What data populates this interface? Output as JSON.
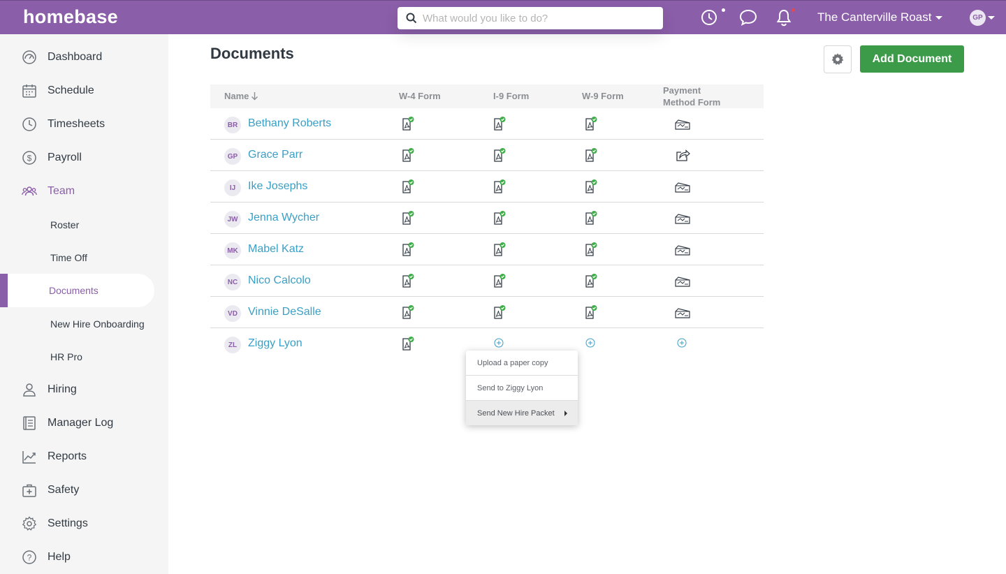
{
  "app": {
    "logo": "homebase"
  },
  "topbar": {
    "search_placeholder": "What would you like to do?",
    "location": "The Canterville Roast",
    "user_initials": "GP",
    "notification_dot_color": "#e5484d"
  },
  "sidebar": {
    "items": [
      {
        "label": "Dashboard",
        "icon": "dashboard-icon"
      },
      {
        "label": "Schedule",
        "icon": "calendar-icon"
      },
      {
        "label": "Timesheets",
        "icon": "clock-icon"
      },
      {
        "label": "Payroll",
        "icon": "dollar-icon"
      },
      {
        "label": "Team",
        "icon": "team-icon",
        "active": true
      },
      {
        "label": "Hiring",
        "icon": "person-icon"
      },
      {
        "label": "Manager Log",
        "icon": "logbook-icon"
      },
      {
        "label": "Reports",
        "icon": "chart-icon"
      },
      {
        "label": "Safety",
        "icon": "first-aid-icon"
      },
      {
        "label": "Settings",
        "icon": "gear-icon"
      },
      {
        "label": "Help",
        "icon": "help-icon"
      }
    ],
    "team_subitems": [
      {
        "label": "Roster"
      },
      {
        "label": "Time Off"
      },
      {
        "label": "Documents",
        "selected": true
      },
      {
        "label": "New Hire Onboarding"
      },
      {
        "label": "HR Pro"
      }
    ]
  },
  "main": {
    "title": "Documents",
    "add_button": "Add Document",
    "accent_green": "#3c9b48",
    "brand_purple": "#8a5ea8"
  },
  "table": {
    "columns": {
      "name": "Name",
      "w4": "W-4 Form",
      "i9": "I-9 Form",
      "w9": "W-9 Form",
      "payment_line1": "Payment",
      "payment_line2": "Method Form"
    },
    "rows": [
      {
        "initials": "BR",
        "name": "Bethany Roberts",
        "w4": "done",
        "i9": "done",
        "w9": "done",
        "payment": "check"
      },
      {
        "initials": "GP",
        "name": "Grace Parr",
        "w4": "done",
        "i9": "done",
        "w9": "done",
        "payment": "share"
      },
      {
        "initials": "IJ",
        "name": "Ike Josephs",
        "w4": "done",
        "i9": "done",
        "w9": "done",
        "payment": "check"
      },
      {
        "initials": "JW",
        "name": "Jenna Wycher",
        "w4": "done",
        "i9": "done",
        "w9": "done",
        "payment": "check"
      },
      {
        "initials": "MK",
        "name": "Mabel Katz",
        "w4": "done",
        "i9": "done",
        "w9": "done",
        "payment": "check"
      },
      {
        "initials": "NC",
        "name": "Nico Calcolo",
        "w4": "done",
        "i9": "done",
        "w9": "done",
        "payment": "check"
      },
      {
        "initials": "VD",
        "name": "Vinnie DeSalle",
        "w4": "done",
        "i9": "done",
        "w9": "done",
        "payment": "check"
      },
      {
        "initials": "ZL",
        "name": "Ziggy Lyon",
        "w4": "done",
        "i9": "add",
        "w9": "add",
        "payment": "add"
      }
    ]
  },
  "dropdown": {
    "items": [
      "Upload a paper copy",
      "Send to Ziggy Lyon",
      "Send New Hire Packet"
    ]
  }
}
